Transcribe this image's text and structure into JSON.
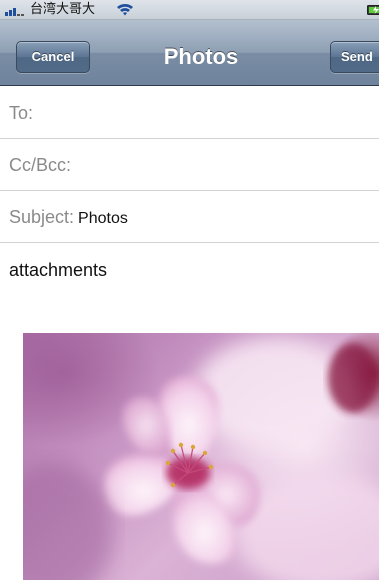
{
  "status_bar": {
    "carrier": "台湾大哥大",
    "icons": [
      "signal-bars-icon",
      "wifi-icon",
      "battery-icon"
    ]
  },
  "nav": {
    "title": "Photos",
    "cancel_label": "Cancel",
    "send_label": "Send"
  },
  "fields": {
    "to_label": "To:",
    "cc_label": "Cc/Bcc:",
    "subject_label": "Subject:",
    "subject_value": "Photos"
  },
  "body": {
    "text": "attachments"
  },
  "colors": {
    "nav_bar": "#7a8da5",
    "field_label": "#8a8a8a",
    "divider": "#d3d3d3"
  }
}
